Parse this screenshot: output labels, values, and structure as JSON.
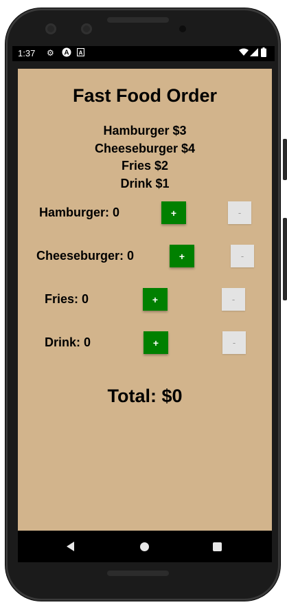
{
  "status_bar": {
    "time": "1:37",
    "icons": [
      "settings-icon",
      "app-a-icon",
      "app-small-a-icon"
    ],
    "right_icons": [
      "wifi-icon",
      "signal-icon",
      "battery-icon"
    ]
  },
  "app": {
    "title": "Fast Food Order",
    "menu": [
      "Hamburger $3",
      "Cheeseburger $4",
      "Fries $2",
      "Drink $1"
    ],
    "items": [
      {
        "label": "Hamburger: 0",
        "plus": "+",
        "minus": "-"
      },
      {
        "label": "Cheeseburger: 0",
        "plus": "+",
        "minus": "-"
      },
      {
        "label": "Fries: 0",
        "plus": "+",
        "minus": "-"
      },
      {
        "label": "Drink: 0",
        "plus": "+",
        "minus": "-"
      }
    ],
    "total": "Total: $0"
  },
  "colors": {
    "background": "#d2b48c",
    "plus_button": "#008000",
    "minus_button": "#e3e3e3"
  }
}
